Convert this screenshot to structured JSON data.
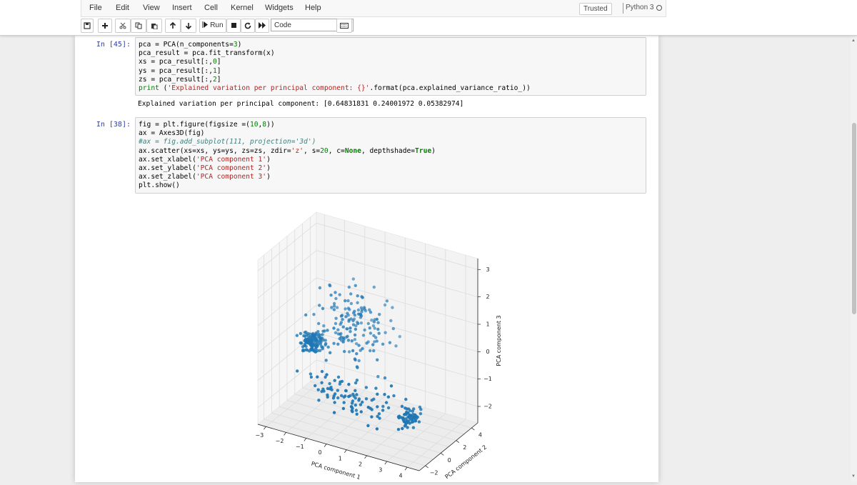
{
  "menu": [
    "File",
    "Edit",
    "View",
    "Insert",
    "Cell",
    "Kernel",
    "Widgets",
    "Help"
  ],
  "trusted_label": "Trusted",
  "kernel_name": "Python 3",
  "toolbar": {
    "run_label": "Run",
    "cell_type": "Code",
    "icons": [
      "save-icon",
      "plus-icon",
      "cut-icon",
      "copy-icon",
      "paste-icon",
      "arrow-up-icon",
      "arrow-down-icon",
      "run-icon",
      "stop-icon",
      "restart-icon",
      "fast-forward-icon",
      "keyboard-icon"
    ]
  },
  "cells": [
    {
      "prompt": "In [45]:",
      "lines": [
        [
          [
            "pca = PCA(n_components=",
            ""
          ],
          [
            "3",
            "n"
          ],
          [
            ")",
            ""
          ]
        ],
        [
          [
            "pca_result = pca.fit_transform(x)",
            ""
          ]
        ],
        [
          [
            "xs = pca_result[:,",
            ""
          ],
          [
            "0",
            "n"
          ],
          [
            "]",
            ""
          ]
        ],
        [
          [
            "ys = pca_result[:,",
            ""
          ],
          [
            "1",
            "n"
          ],
          [
            "]",
            ""
          ]
        ],
        [
          [
            "zs = pca_result[:,",
            ""
          ],
          [
            "2",
            "n"
          ],
          [
            "]",
            ""
          ]
        ],
        [
          [
            "print",
            "n"
          ],
          [
            " (",
            ""
          ],
          [
            "'Explained variation per principal component: {}'",
            "s"
          ],
          [
            ".format(pca.explained_variance_ratio_))",
            ""
          ]
        ]
      ],
      "output": "Explained variation per principal component: [0.64831831 0.24001972 0.05382974]"
    },
    {
      "prompt": "In [38]:",
      "lines": [
        [
          [
            "fig = plt.figure(figsize =(",
            ""
          ],
          [
            "10",
            "n"
          ],
          [
            ",",
            ""
          ],
          [
            "8",
            "n"
          ],
          [
            "))",
            ""
          ]
        ],
        [
          [
            "ax = Axes3D(fig)",
            ""
          ]
        ],
        [
          [
            "#ax = fig.add_subplot(111, projection='3d')",
            "c"
          ]
        ],
        [
          [
            "ax.scatter(xs=xs, ys=ys, zs=zs, zdir=",
            ""
          ],
          [
            "'z'",
            "s"
          ],
          [
            ", s=",
            ""
          ],
          [
            "20",
            "n"
          ],
          [
            ", c=",
            ""
          ],
          [
            "None",
            "k"
          ],
          [
            ", depthshade=",
            ""
          ],
          [
            "True",
            "k"
          ],
          [
            ")",
            ""
          ]
        ],
        [
          [
            "ax.set_xlabel(",
            ""
          ],
          [
            "'PCA component 1'",
            "s"
          ],
          [
            ")",
            ""
          ]
        ],
        [
          [
            "ax.set_ylabel(",
            ""
          ],
          [
            "'PCA component 2'",
            "s"
          ],
          [
            ")",
            ""
          ]
        ],
        [
          [
            "ax.set_zlabel(",
            ""
          ],
          [
            "'PCA component 3'",
            "s"
          ],
          [
            ")",
            ""
          ]
        ],
        [
          [
            "plt.show()",
            ""
          ]
        ]
      ]
    }
  ],
  "chart_data": {
    "type": "scatter",
    "projection": "3d",
    "xlabel": "PCA component 1",
    "ylabel": "PCA component 2",
    "zlabel": "PCA component 3",
    "x_ticks": [
      -3,
      -2,
      -1,
      0,
      1,
      2,
      3,
      4
    ],
    "y_ticks": [
      -2,
      0,
      2,
      4
    ],
    "z_ticks": [
      -2,
      -1,
      0,
      1,
      2,
      3
    ],
    "point_color": "#1f77b4",
    "clusters": [
      {
        "x": -1.8,
        "y": 0.2,
        "z": 0.1,
        "spread": [
          0.35,
          0.45,
          0.25
        ],
        "count": 130
      },
      {
        "x": 3.6,
        "y": -1.4,
        "z": -1.2,
        "spread": [
          0.25,
          0.6,
          0.3
        ],
        "count": 70
      },
      {
        "x": 0.8,
        "y": -1.6,
        "z": -1.0,
        "spread": [
          1.6,
          0.6,
          0.45
        ],
        "count": 90
      },
      {
        "x": 0.0,
        "y": 1.2,
        "z": 0.9,
        "spread": [
          1.3,
          1.2,
          0.9
        ],
        "count": 150
      }
    ]
  }
}
